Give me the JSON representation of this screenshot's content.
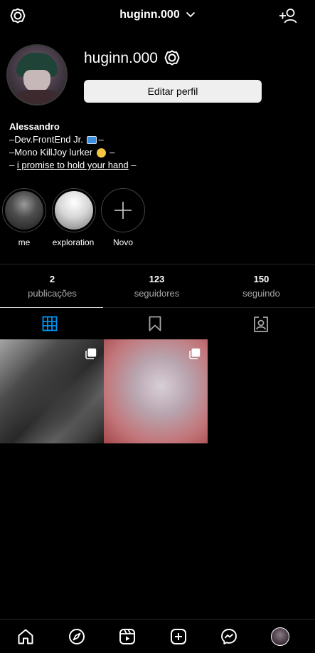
{
  "header": {
    "username": "huginn.000",
    "icons": {
      "left": "gear-icon",
      "dropdown": "chevron-down-icon",
      "right": "add-user-icon"
    }
  },
  "profile": {
    "username": "huginn.000",
    "edit_button": "Editar perfil",
    "settings_icon": "gear-icon"
  },
  "bio": {
    "name": "Alessandro",
    "line1_prefix": "–Dev.FrontEnd Jr.",
    "line1_suffix": "–",
    "line2_prefix": "–Mono KillJoy lurker",
    "line2_suffix": "–",
    "line3_prefix": "– ",
    "line3_link": "i promise to hold your hand",
    "line3_suffix": " –"
  },
  "highlights": [
    {
      "label": "me"
    },
    {
      "label": "exploration"
    },
    {
      "label": "Novo"
    }
  ],
  "stats": [
    {
      "value": "2",
      "label": "publicações"
    },
    {
      "value": "123",
      "label": "seguidores"
    },
    {
      "value": "150",
      "label": "seguindo"
    }
  ],
  "tabs": [
    {
      "icon": "grid-icon",
      "active": true
    },
    {
      "icon": "bookmark-icon",
      "active": false
    },
    {
      "icon": "tagged-user-icon",
      "active": false
    }
  ],
  "posts": [
    {
      "type": "carousel",
      "icon": "multiple-posts-icon"
    },
    {
      "type": "carousel",
      "icon": "multiple-posts-icon"
    }
  ],
  "bottom_nav": [
    "home-icon",
    "explore-icon",
    "reels-icon",
    "new-post-icon",
    "messenger-icon",
    "profile-avatar"
  ],
  "colors": {
    "background": "#000000",
    "text": "#ffffff",
    "muted": "#a8a8a8",
    "button_bg": "#efefef",
    "accent": "#0095f6"
  }
}
